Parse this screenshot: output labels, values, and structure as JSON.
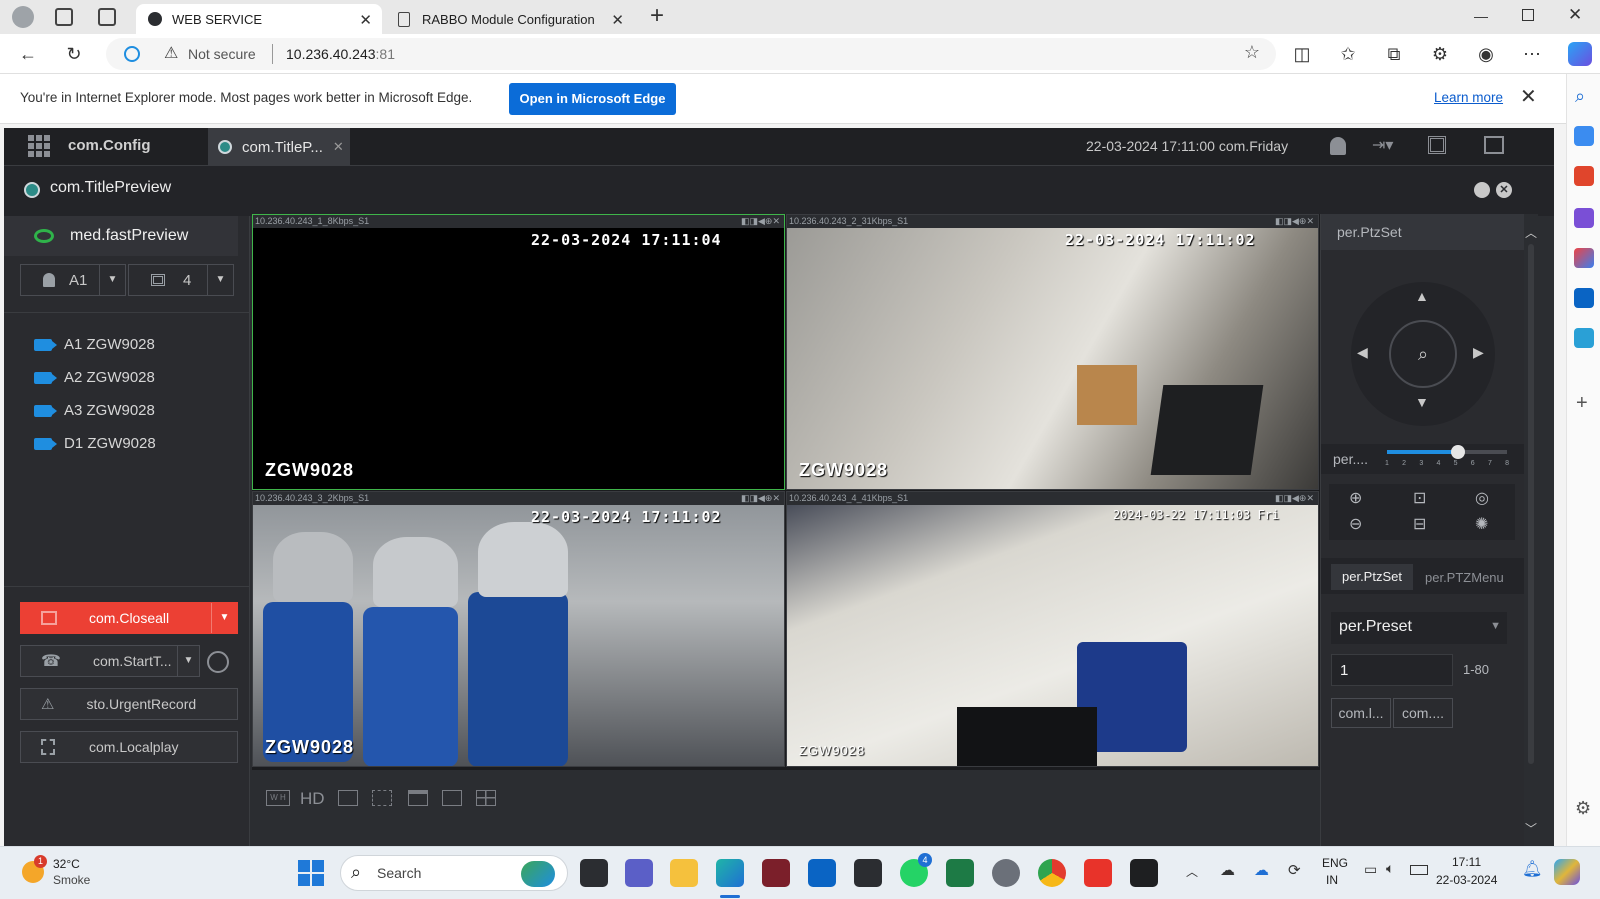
{
  "browser": {
    "tabs": [
      {
        "title": "WEB SERVICE",
        "active": true
      },
      {
        "title": "RABBO Module Configuration",
        "active": false
      }
    ],
    "new_tab_label": "+",
    "security": "Not secure",
    "url_host": "10.236.40.243",
    "url_port": ":81",
    "ie_banner": {
      "message": "You're in Internet Explorer mode. Most pages work better in Microsoft Edge.",
      "open_button": "Open in Microsoft Edge",
      "learn_more": "Learn more"
    }
  },
  "app": {
    "top": {
      "config_tab": "com.Config",
      "preview_tab": "com.TitleP...",
      "datetime": "22-03-2024 17:11:00 com.Friday"
    },
    "panel_title": "com.TitlePreview",
    "left": {
      "fast_preview": "med.fastPreview",
      "channel_select": "A1",
      "layout_select": "4",
      "devices": [
        "A1 ZGW9028",
        "A2 ZGW9028",
        "A3 ZGW9028",
        "D1 ZGW9028"
      ],
      "close_all": "com.Closeall",
      "start_talk": "com.StartT...",
      "urgent_record": "sto.UrgentRecord",
      "local_play": "com.Localplay"
    },
    "videos": [
      {
        "caption": "10.236.40.243_1_8Kbps_S1",
        "timestamp": "22-03-2024 17:11:04",
        "name": "ZGW9028"
      },
      {
        "caption": "10.236.40.243_2_31Kbps_S1",
        "timestamp": "22-03-2024 17:11:02",
        "name": "ZGW9028"
      },
      {
        "caption": "10.236.40.243_3_2Kbps_S1",
        "timestamp": "22-03-2024 17:11:02",
        "name": "ZGW9028"
      },
      {
        "caption": "10.236.40.243_4_41Kbps_S1",
        "timestamp": "2024-03-22 17:11:03 Fri",
        "name": "ZGW9028"
      }
    ],
    "video_toolbar": {
      "hd_label": "HD"
    },
    "right": {
      "ptz_title": "per.PtzSet",
      "speed_label": "per....",
      "speed_ticks": [
        "1",
        "2",
        "3",
        "4",
        "5",
        "6",
        "7",
        "8"
      ],
      "speed_value": 5,
      "tab_ptzset": "per.PtzSet",
      "tab_ptzmenu": "per.PTZMenu",
      "preset_select": "per.Preset",
      "preset_value": "1",
      "preset_range": "1-80",
      "btn1": "com.l...",
      "btn2": "com...."
    }
  },
  "taskbar": {
    "weather_temp": "32°C",
    "weather_desc": "Smoke",
    "weather_badge": "1",
    "search_placeholder": "Search",
    "whatsapp_badge": "4",
    "lang_top": "ENG",
    "lang_bottom": "IN",
    "time": "17:11",
    "date": "22-03-2024"
  }
}
